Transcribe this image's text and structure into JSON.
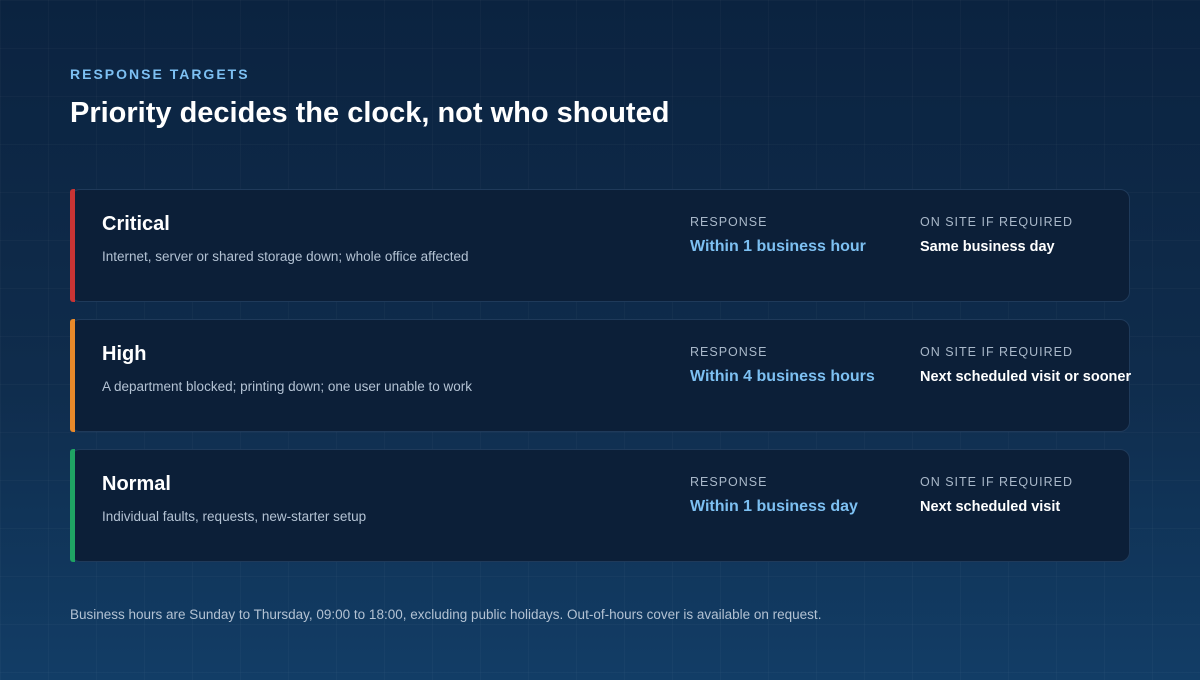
{
  "header": {
    "eyebrow": "RESPONSE TARGETS",
    "title": "Priority decides the clock, not who shouted"
  },
  "columns": {
    "response_label": "RESPONSE",
    "onsite_label": "ON SITE IF REQUIRED"
  },
  "colors": {
    "critical": "#c93434",
    "high": "#e8892a",
    "normal": "#1fa463",
    "accent_text": "#7dc0f2"
  },
  "priorities": [
    {
      "name": "Critical",
      "description": "Internet, server or shared storage down; whole office affected",
      "response": "Within 1 business hour",
      "onsite": "Same business day"
    },
    {
      "name": "High",
      "description": "A department blocked; printing down; one user unable to work",
      "response": "Within 4 business hours",
      "onsite": "Next scheduled visit or sooner"
    },
    {
      "name": "Normal",
      "description": "Individual faults, requests, new-starter setup",
      "response": "Within 1 business day",
      "onsite": "Next scheduled visit"
    }
  ],
  "footer": {
    "note": "Business hours are Sunday to Thursday, 09:00 to 18:00, excluding public holidays. Out-of-hours cover is available on request."
  }
}
